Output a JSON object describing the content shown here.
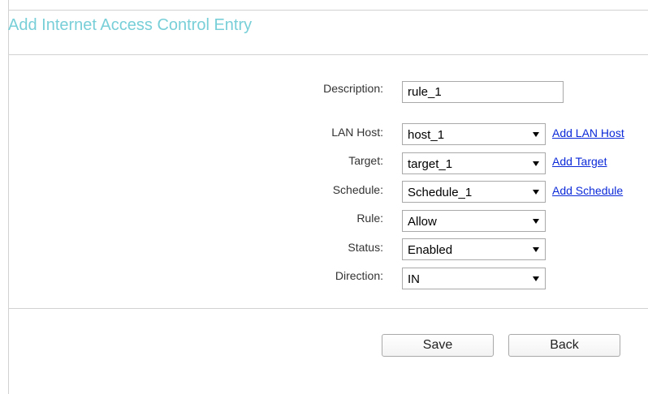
{
  "page": {
    "title": "Add Internet Access Control Entry"
  },
  "form": {
    "description": {
      "label": "Description:",
      "value": "rule_1"
    },
    "lan_host": {
      "label": "LAN Host:",
      "value": "host_1",
      "link": "Add LAN Host"
    },
    "target": {
      "label": "Target:",
      "value": "target_1",
      "link": "Add Target"
    },
    "schedule": {
      "label": "Schedule:",
      "value": "Schedule_1",
      "link": "Add Schedule"
    },
    "rule": {
      "label": "Rule:",
      "value": "Allow"
    },
    "status": {
      "label": "Status:",
      "value": "Enabled"
    },
    "direction": {
      "label": "Direction:",
      "value": "IN"
    }
  },
  "buttons": {
    "save": "Save",
    "back": "Back"
  },
  "colors": {
    "title": "#78cfd8",
    "link": "#0b29d8",
    "divider": "#d2d2d2"
  },
  "icons": {
    "dropdown": "chevron-down-icon"
  }
}
